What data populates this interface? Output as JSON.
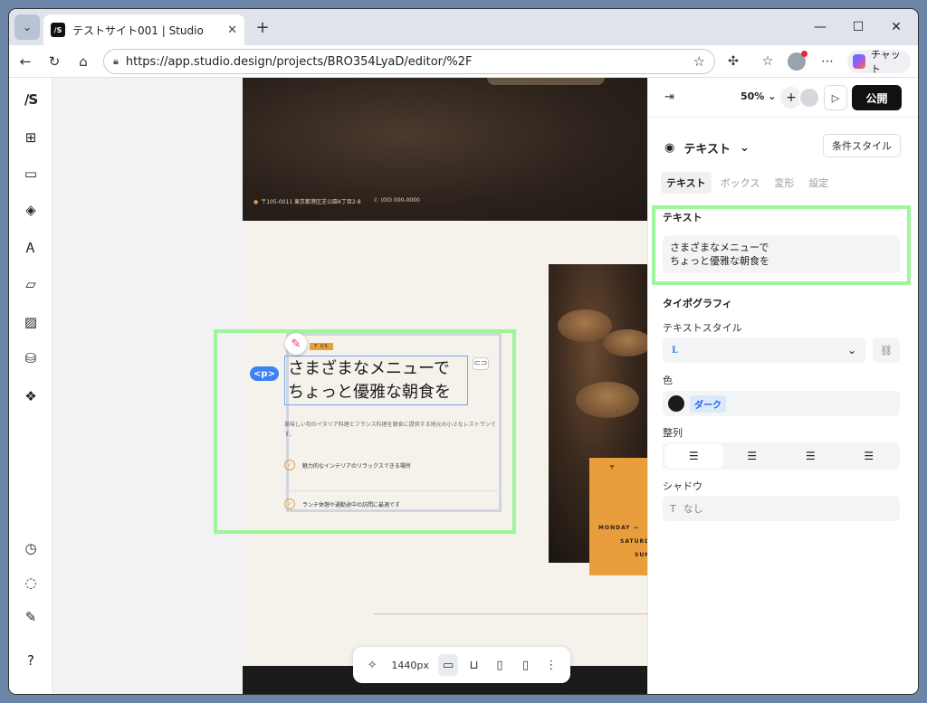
{
  "browser": {
    "tab_title": "テストサイト001 | Studio",
    "favicon": "/S",
    "url": "https://app.studio.design/projects/BRO354LyaD/editor/%2F",
    "chat_label": "チャット"
  },
  "studio": {
    "logo": "/S",
    "zoom": "50%",
    "publish_label": "公開",
    "element_type": "テキスト",
    "condition_style_label": "条件スタイル",
    "tabs": [
      "テキスト",
      "ボックス",
      "変形",
      "設定"
    ],
    "text_section": "テキスト",
    "text_value_line1": "さまざまなメニューで",
    "text_value_line2": "ちょっと優雅な朝食を",
    "typography_section": "タイポグラフィ",
    "text_style_label": "テキストスタイル",
    "text_style_value": "L",
    "color_label": "色",
    "color_value": "ダーク",
    "align_label": "整列",
    "shadow_label": "シャドウ",
    "shadow_value": "なし"
  },
  "canvas": {
    "address": "〒105-0011 東京都港区芝公園4丁目2-8",
    "phone": "(00) 000-0000",
    "about_badge": "T US",
    "heading_line1": "さまざまなメニューで",
    "heading_line2": "ちょっと優雅な朝食を",
    "description": "美味しい旬のイタリア料理とフランス料理を朝食に提供する地元の小さなレストランです。",
    "feature1": "魅力的なインテリアのリラックスできる場所",
    "feature2": "ランチ休憩や通勤途中の訪問に最適です",
    "tag_label": "<p>",
    "hours_line1": "MONDAY —",
    "hours_line2": "SATURD",
    "hours_line3": "SUN",
    "hours_tag": "〒"
  },
  "toolbar": {
    "width_label": "1440px"
  }
}
